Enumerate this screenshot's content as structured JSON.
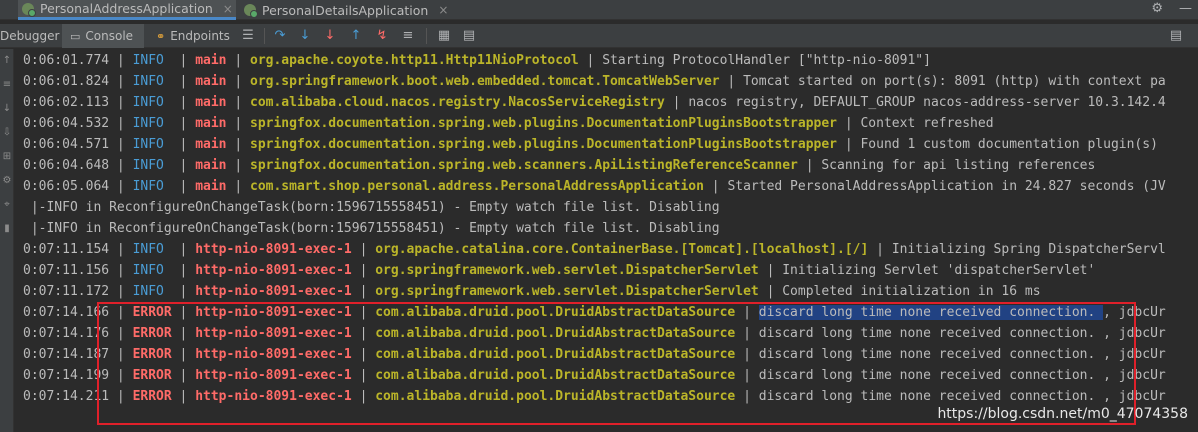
{
  "run_tabs": [
    {
      "label": "PersonalAddressApplication",
      "close": "×"
    },
    {
      "label": "PersonalDetailsApplication",
      "close": "×"
    }
  ],
  "tool_tabs": {
    "debugger": "Debugger",
    "console": "Console",
    "endpoints": "Endpoints"
  },
  "icons": {
    "settings": "⚙",
    "minimize": "—",
    "menu": "☰",
    "step_over": "↷",
    "step_into": "↓",
    "force_step_into": "↓",
    "step_out": "↑",
    "run_to_cursor": "↯",
    "table": "▦",
    "more": "≡",
    "layout": "▤",
    "console_icon": "▭",
    "endpoints_icon": "⚭"
  },
  "gutter_icons": [
    "↑",
    "≡",
    "↓",
    "⇩",
    "⊞",
    "⚙",
    "⌖",
    "▮"
  ],
  "log_lines": [
    {
      "time": "0:06:01.774",
      "level": "INFO",
      "thread": "main",
      "logger": "org.apache.coyote.http11.Http11NioProtocol",
      "message": "Starting ProtocolHandler [\"http-nio-8091\"]"
    },
    {
      "time": "0:06:01.824",
      "level": "INFO",
      "thread": "main",
      "logger": "org.springframework.boot.web.embedded.tomcat.TomcatWebServer",
      "message": "Tomcat started on port(s): 8091 (http) with context pa"
    },
    {
      "time": "0:06:02.113",
      "level": "INFO",
      "thread": "main",
      "logger": "com.alibaba.cloud.nacos.registry.NacosServiceRegistry",
      "message": "nacos registry, DEFAULT_GROUP nacos-address-server 10.3.142.4"
    },
    {
      "time": "0:06:04.532",
      "level": "INFO",
      "thread": "main",
      "logger": "springfox.documentation.spring.web.plugins.DocumentationPluginsBootstrapper",
      "message": "Context refreshed"
    },
    {
      "time": "0:06:04.571",
      "level": "INFO",
      "thread": "main",
      "logger": "springfox.documentation.spring.web.plugins.DocumentationPluginsBootstrapper",
      "message": "Found 1 custom documentation plugin(s)"
    },
    {
      "time": "0:06:04.648",
      "level": "INFO",
      "thread": "main",
      "logger": "springfox.documentation.spring.web.scanners.ApiListingReferenceScanner",
      "message": "Scanning for api listing references"
    },
    {
      "time": "0:06:05.064",
      "level": "INFO",
      "thread": "main",
      "logger": "com.smart.shop.personal.address.PersonalAddressApplication",
      "message": "Started PersonalAddressApplication in 24.827 seconds (JV"
    },
    {
      "raw": "|-INFO in ReconfigureOnChangeTask(born:1596715558451) - Empty watch file list. Disabling"
    },
    {
      "raw": "|-INFO in ReconfigureOnChangeTask(born:1596715558451) - Empty watch file list. Disabling"
    },
    {
      "time": "0:07:11.154",
      "level": "INFO",
      "thread": "http-nio-8091-exec-1",
      "logger": "org.apache.catalina.core.ContainerBase.[Tomcat].[localhost].[/]",
      "message": "Initializing Spring DispatcherServl"
    },
    {
      "time": "0:07:11.156",
      "level": "INFO",
      "thread": "http-nio-8091-exec-1",
      "logger": "org.springframework.web.servlet.DispatcherServlet",
      "message": "Initializing Servlet 'dispatcherServlet'"
    },
    {
      "time": "0:07:11.172",
      "level": "INFO",
      "thread": "http-nio-8091-exec-1",
      "logger": "org.springframework.web.servlet.DispatcherServlet",
      "message": "Completed initialization in 16 ms"
    },
    {
      "time": "0:07:14.166",
      "level": "ERROR",
      "thread": "http-nio-8091-exec-1",
      "logger": "com.alibaba.druid.pool.DruidAbstractDataSource",
      "message": "discard long time none received connection. ",
      "tail": ", jdbcUr",
      "selected": true
    },
    {
      "time": "0:07:14.176",
      "level": "ERROR",
      "thread": "http-nio-8091-exec-1",
      "logger": "com.alibaba.druid.pool.DruidAbstractDataSource",
      "message": "discard long time none received connection. ",
      "tail": ", jdbcUr"
    },
    {
      "time": "0:07:14.187",
      "level": "ERROR",
      "thread": "http-nio-8091-exec-1",
      "logger": "com.alibaba.druid.pool.DruidAbstractDataSource",
      "message": "discard long time none received connection. ",
      "tail": ", jdbcUr"
    },
    {
      "time": "0:07:14.199",
      "level": "ERROR",
      "thread": "http-nio-8091-exec-1",
      "logger": "com.alibaba.druid.pool.DruidAbstractDataSource",
      "message": "discard long time none received connection. ",
      "tail": ", jdbcUr"
    },
    {
      "time": "0:07:14.211",
      "level": "ERROR",
      "thread": "http-nio-8091-exec-1",
      "logger": "com.alibaba.druid.pool.DruidAbstractDataSource",
      "message": "discard long time none received connection. ",
      "tail": ", jdbcUr"
    }
  ],
  "watermark": "https://blog.csdn.net/m0_47074358",
  "colors": {
    "background": "#2b2b2b",
    "info": "#4a9dd6",
    "error": "#ff6b68",
    "logger": "#bbb529",
    "selection": "#214283",
    "highlight_box": "#e0202a"
  }
}
